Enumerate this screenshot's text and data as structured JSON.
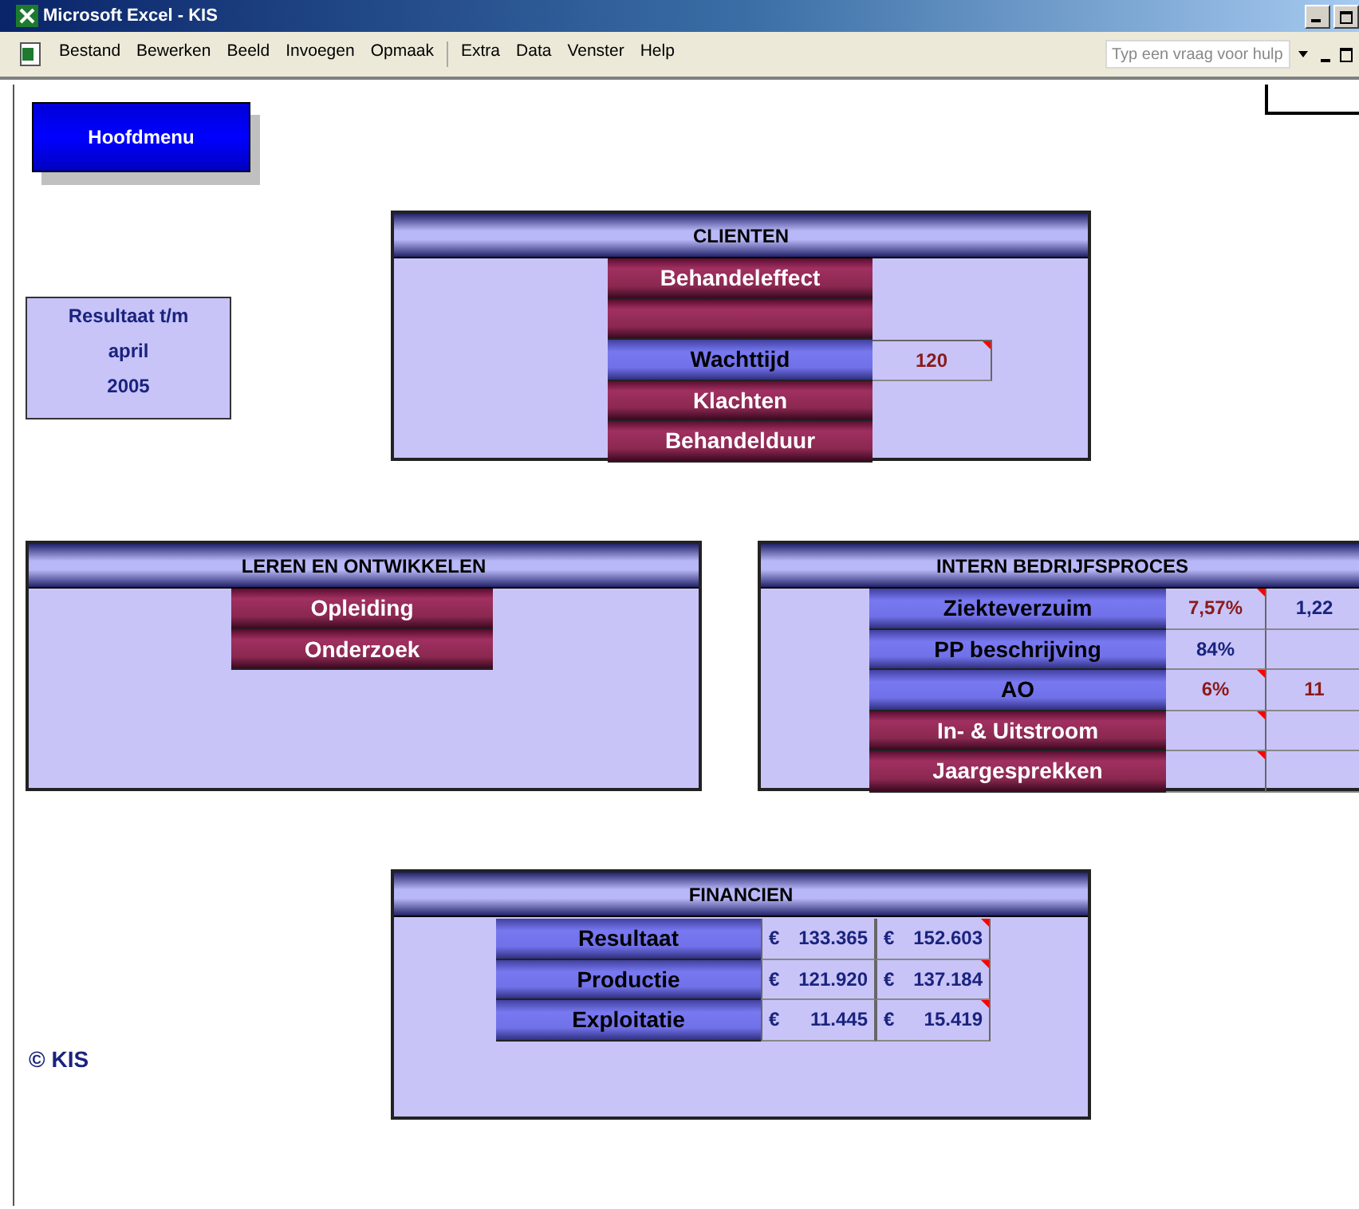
{
  "window": {
    "title": "Microsoft Excel - KIS"
  },
  "menu": [
    [
      "Bestand",
      "Bewerken",
      "Beeld",
      "Invoegen",
      "Opmaak"
    ],
    [
      "Extra",
      "Data",
      "Venster",
      "Help"
    ]
  ],
  "help_field": {
    "placeholder": "Typ een vraag voor hulp"
  },
  "main_button": "Hoofdmenu",
  "period": [
    "Resultaat t/m",
    "april",
    "2005"
  ],
  "panels": [
    {
      "title": "CLIENTEN",
      "rows": [
        {
          "label": "Behandeleffect",
          "kind": "maroon",
          "values": []
        },
        {
          "kind": "maroon",
          "values": []
        },
        {
          "label": "Wachttijd",
          "kind": "blue",
          "values": [
            {
              "text": "120",
              "color": "#8b1a1a",
              "comment": true
            }
          ]
        },
        {
          "label": "Klachten",
          "kind": "maroon",
          "values": []
        },
        {
          "label": "Behandelduur",
          "kind": "maroon",
          "values": []
        }
      ]
    },
    {
      "title": "LEREN EN ONTWIKKELEN",
      "rows": [
        {
          "label": "Opleiding",
          "kind": "maroon",
          "values": []
        },
        {
          "label": "Onderzoek",
          "kind": "maroon",
          "values": []
        }
      ]
    },
    {
      "title": "INTERN BEDRIJFSPROCES",
      "rows": [
        {
          "label": "Ziekteverzuim",
          "kind": "blue",
          "values": [
            {
              "text": "7,57%",
              "color": "#8b1a1a",
              "comment": true
            },
            {
              "text": "1,22",
              "color": "#1a237e",
              "comment": false
            }
          ]
        },
        {
          "label": "PP beschrijving",
          "kind": "blue",
          "values": [
            {
              "text": "84%",
              "color": "#1a237e",
              "comment": false
            },
            {
              "comment": false
            }
          ]
        },
        {
          "label": "AO",
          "kind": "blue",
          "values": [
            {
              "text": "6%",
              "color": "#8b1a1a",
              "comment": true
            },
            {
              "text": "11",
              "color": "#8b1a1a",
              "comment": false
            }
          ]
        },
        {
          "label": "In- & Uitstroom",
          "kind": "maroon",
          "values": [
            {
              "comment": true
            },
            {
              "comment": false
            }
          ]
        },
        {
          "label": "Jaargesprekken",
          "kind": "maroon",
          "values": [
            {
              "comment": true
            },
            {
              "comment": false
            }
          ]
        }
      ]
    },
    {
      "title": "FINANCIEN",
      "rows": [
        {
          "label": "Resultaat",
          "kind": "blue",
          "values": [
            {
              "currency": "€",
              "text": "133.365",
              "color": "#1a237e",
              "comment": false
            },
            {
              "currency": "€",
              "text": "152.603",
              "color": "#1a237e",
              "comment": true
            }
          ]
        },
        {
          "label": "Productie",
          "kind": "blue",
          "values": [
            {
              "currency": "€",
              "text": "121.920",
              "color": "#1a237e",
              "comment": false
            },
            {
              "currency": "€",
              "text": "137.184",
              "color": "#1a237e",
              "comment": true
            }
          ]
        },
        {
          "label": "Exploitatie",
          "kind": "blue",
          "values": [
            {
              "currency": "€",
              "text": "11.445",
              "color": "#1a237e",
              "comment": false
            },
            {
              "currency": "€",
              "text": "15.419",
              "color": "#1a237e",
              "comment": true
            }
          ]
        }
      ]
    }
  ],
  "copyright": "© KIS"
}
